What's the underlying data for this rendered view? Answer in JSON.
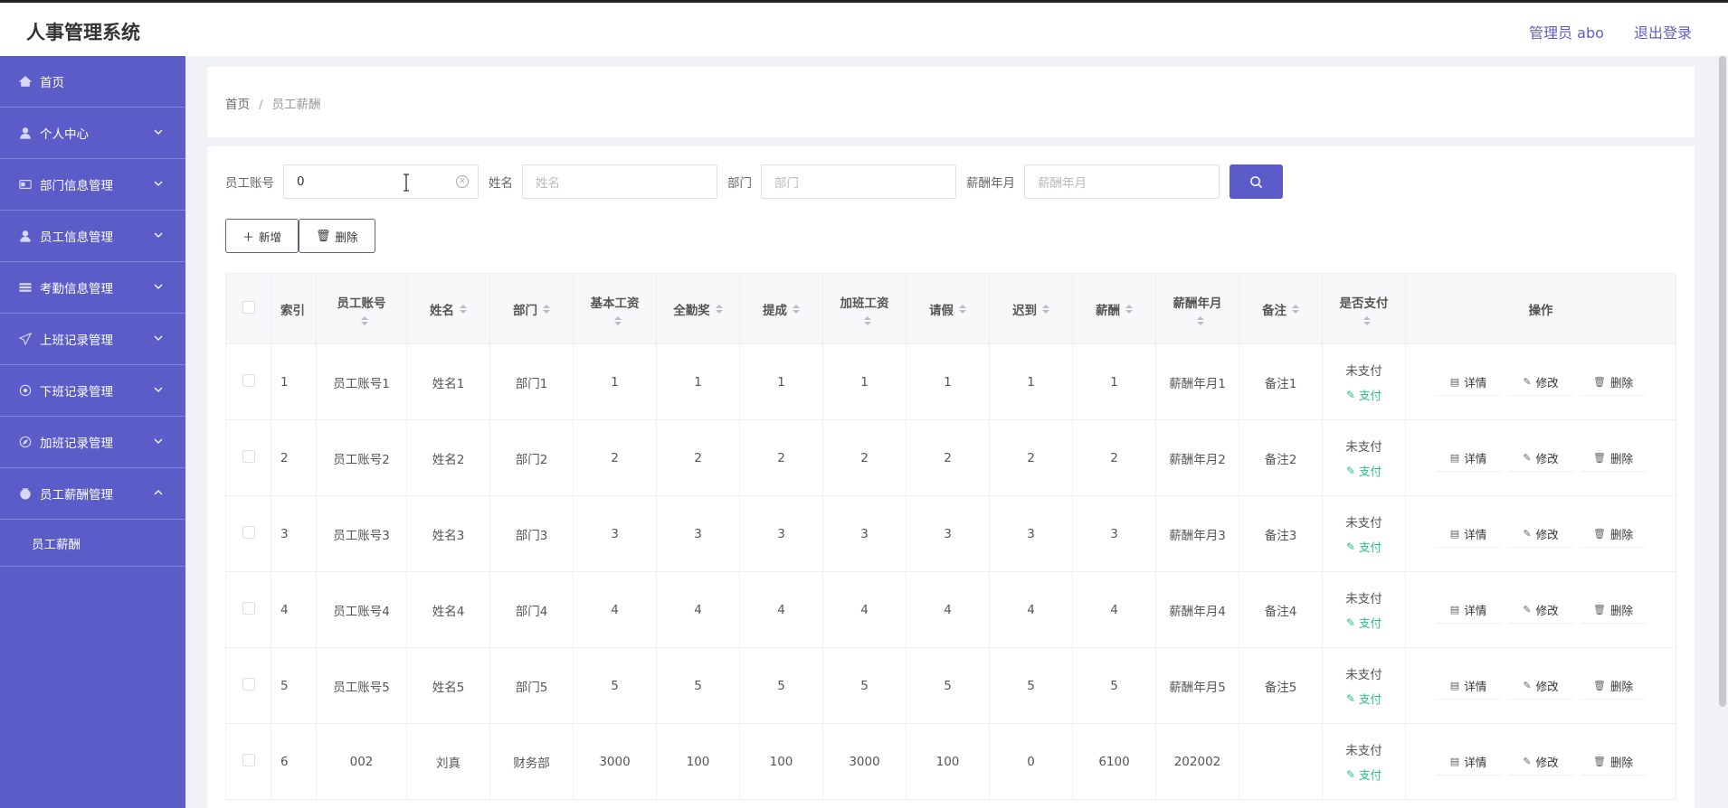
{
  "header": {
    "title": "人事管理系统",
    "admin": "管理员 abo",
    "logout": "退出登录"
  },
  "sidebar": {
    "items": [
      {
        "label": "首页",
        "icon": "home-icon",
        "chevron": false
      },
      {
        "label": "个人中心",
        "icon": "user-icon",
        "chevron": true
      },
      {
        "label": "部门信息管理",
        "icon": "card-icon",
        "chevron": true
      },
      {
        "label": "员工信息管理",
        "icon": "user-icon",
        "chevron": true
      },
      {
        "label": "考勤信息管理",
        "icon": "list-icon",
        "chevron": true
      },
      {
        "label": "上班记录管理",
        "icon": "send-icon",
        "chevron": true
      },
      {
        "label": "下班记录管理",
        "icon": "target-icon",
        "chevron": true
      },
      {
        "label": "加班记录管理",
        "icon": "compass-icon",
        "chevron": true
      },
      {
        "label": "员工薪酬管理",
        "icon": "money-icon",
        "chevron": true,
        "expanded": true
      }
    ],
    "sub_item": "员工薪酬"
  },
  "breadcrumb": {
    "home": "首页",
    "sep": "/",
    "current": "员工薪酬"
  },
  "search": {
    "account_label": "员工账号",
    "account_value": "0",
    "name_label": "姓名",
    "name_placeholder": "姓名",
    "dept_label": "部门",
    "dept_placeholder": "部门",
    "month_label": "薪酬年月",
    "month_placeholder": "薪酬年月"
  },
  "actions": {
    "add": "新增",
    "delete": "删除"
  },
  "table": {
    "headers": {
      "index": "索引",
      "account": "员工账号",
      "name": "姓名",
      "dept": "部门",
      "base": "基本工资",
      "attendance": "全勤奖",
      "commission": "提成",
      "overtime": "加班工资",
      "leave": "请假",
      "late": "迟到",
      "salary": "薪酬",
      "month": "薪酬年月",
      "remark": "备注",
      "paid": "是否支付",
      "ops": "操作"
    },
    "rows": [
      {
        "index": "1",
        "account": "员工账号1",
        "name": "姓名1",
        "dept": "部门1",
        "base": "1",
        "attendance": "1",
        "commission": "1",
        "overtime": "1",
        "leave": "1",
        "late": "1",
        "salary": "1",
        "month": "薪酬年月1",
        "remark": "备注1",
        "paid": "未支付"
      },
      {
        "index": "2",
        "account": "员工账号2",
        "name": "姓名2",
        "dept": "部门2",
        "base": "2",
        "attendance": "2",
        "commission": "2",
        "overtime": "2",
        "leave": "2",
        "late": "2",
        "salary": "2",
        "month": "薪酬年月2",
        "remark": "备注2",
        "paid": "未支付"
      },
      {
        "index": "3",
        "account": "员工账号3",
        "name": "姓名3",
        "dept": "部门3",
        "base": "3",
        "attendance": "3",
        "commission": "3",
        "overtime": "3",
        "leave": "3",
        "late": "3",
        "salary": "3",
        "month": "薪酬年月3",
        "remark": "备注3",
        "paid": "未支付"
      },
      {
        "index": "4",
        "account": "员工账号4",
        "name": "姓名4",
        "dept": "部门4",
        "base": "4",
        "attendance": "4",
        "commission": "4",
        "overtime": "4",
        "leave": "4",
        "late": "4",
        "salary": "4",
        "month": "薪酬年月4",
        "remark": "备注4",
        "paid": "未支付"
      },
      {
        "index": "5",
        "account": "员工账号5",
        "name": "姓名5",
        "dept": "部门5",
        "base": "5",
        "attendance": "5",
        "commission": "5",
        "overtime": "5",
        "leave": "5",
        "late": "5",
        "salary": "5",
        "month": "薪酬年月5",
        "remark": "备注5",
        "paid": "未支付"
      },
      {
        "index": "6",
        "account": "002",
        "name": "刘真",
        "dept": "财务部",
        "base": "3000",
        "attendance": "100",
        "commission": "100",
        "overtime": "3000",
        "leave": "100",
        "late": "0",
        "salary": "6100",
        "month": "202002",
        "remark": "",
        "paid": "未支付"
      }
    ],
    "pay_label": "支付",
    "op_detail": "详情",
    "op_edit": "修改",
    "op_delete": "删除"
  },
  "colors": {
    "sidebar": "#5b5cc7",
    "accent": "#5b5cc7",
    "pay_link": "#22c27d"
  }
}
